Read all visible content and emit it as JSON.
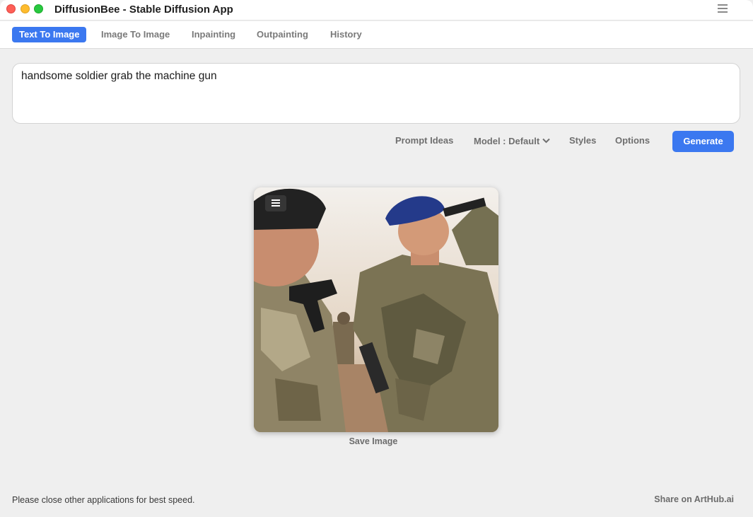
{
  "window": {
    "title": "DiffusionBee - Stable Diffusion App"
  },
  "tabs": [
    {
      "label": "Text To Image",
      "active": true
    },
    {
      "label": "Image To Image",
      "active": false
    },
    {
      "label": "Inpainting",
      "active": false
    },
    {
      "label": "Outpainting",
      "active": false
    },
    {
      "label": "History",
      "active": false
    }
  ],
  "prompt": {
    "value": "handsome soldier grab the machine gun"
  },
  "toolbar": {
    "prompt_ideas": "Prompt Ideas",
    "model": "Model : Default",
    "styles": "Styles",
    "options": "Options",
    "generate": "Generate"
  },
  "result": {
    "save_label": "Save Image"
  },
  "footer": {
    "hint": "Please close other applications for best speed.",
    "share": "Share on ArtHub.ai"
  },
  "colors": {
    "accent": "#3b78f0",
    "close": "#fe5f57",
    "minimize": "#febc2e",
    "maximize": "#28c840"
  },
  "icons": [
    "hamburger-menu-icon",
    "chevron-down-icon",
    "image-menu-icon"
  ]
}
